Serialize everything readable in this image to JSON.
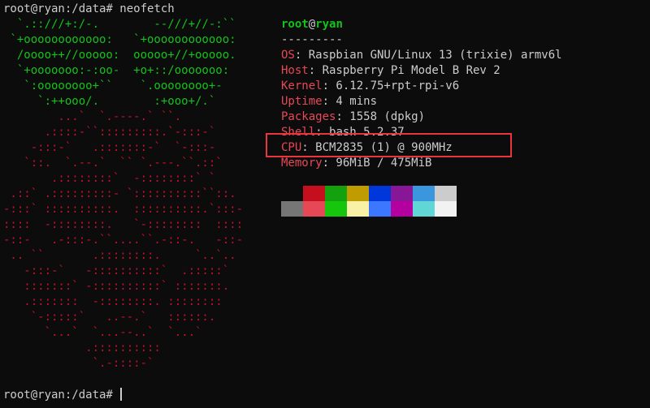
{
  "terminal": {
    "command_prompt": "root@ryan:/data# ",
    "command": "neofetch",
    "final_prompt": "root@ryan:/data# "
  },
  "colors": {
    "background": "#0c0c0c",
    "text": "#cccccc",
    "logo_green": "#13c21b",
    "logo_red": "#c8102e",
    "key_red": "#e74856",
    "highlight_border": "#e8353e"
  },
  "logo": {
    "green_rows": [
      "  `.::///+:/-.        --///+//-:``",
      " `+oooooooooooo:   `+oooooooooooo:",
      "  /oooo++//ooooo:  ooooo+//+ooooo.",
      "  `+ooooooo:-:oo-  +o+::/ooooooo:",
      "   `:oooooooo+``    `.oooooooo+-",
      "     `:++ooo/.        :+ooo+/.`"
    ],
    "red_rows": [
      "        ...`  `.----.` ``.",
      "      .::::-``:::::::::.`-:::-`",
      "    -:::-`   .:::::::-`  `-:::-",
      "   `::.  `.--.`  `` `.---.``.::`",
      "       .::::::::`  -::::::::` `",
      " .::` .:::::::::- `::::::::::``::.",
      "-:::` ::::::::::.  ::::::::::.`:::-",
      "::::  -::::::::.   `-::::::::  ::::",
      "-::-   .-:::-.``....``.-::-.   -::-",
      " .. ``       .::::::::.     `..`..",
      "   -:::-`   -::::::::::`  .:::::`",
      "   :::::::` -::::::::::` :::::::.",
      "   .:::::::  -::::::::. ::::::::",
      "    `-:::::`   ..--.`   ::::::.",
      "      `...`  `...--..`  `...`",
      "            .::::::::::",
      "             `.-::::-`"
    ]
  },
  "info": {
    "user": "root",
    "at": "@",
    "host": "ryan",
    "separator": "---------",
    "os_key": "OS",
    "os_value": ": Raspbian GNU/Linux 13 (trixie) armv6l",
    "host_key": "Host",
    "host_value": ": Raspberry Pi Model B Rev 2",
    "kernel_key": "Kernel",
    "kernel_value": ": 6.12.75+rpt-rpi-v6",
    "uptime_key": "Uptime",
    "uptime_value": ": 4 mins",
    "packages_key": "Packages",
    "packages_value": ": 1558 (dpkg)",
    "shell_key": "Shell",
    "shell_value": ": bash 5.2.37",
    "cpu_key": "CPU",
    "cpu_value": ": BCM2835 (1) @ 900MHz",
    "memory_key": "Memory",
    "memory_value": ": 96MiB / 475MiB"
  },
  "palette": {
    "normal": [
      "#0c0c0c",
      "#c50f1f",
      "#13a10e",
      "#c19c00",
      "#0037da",
      "#881798",
      "#3a96dd",
      "#cccccc"
    ],
    "bright": [
      "#767676",
      "#e74856",
      "#16c60c",
      "#f9f1a5",
      "#3b78ff",
      "#b4009e",
      "#61d6d6",
      "#f2f2f2"
    ]
  }
}
